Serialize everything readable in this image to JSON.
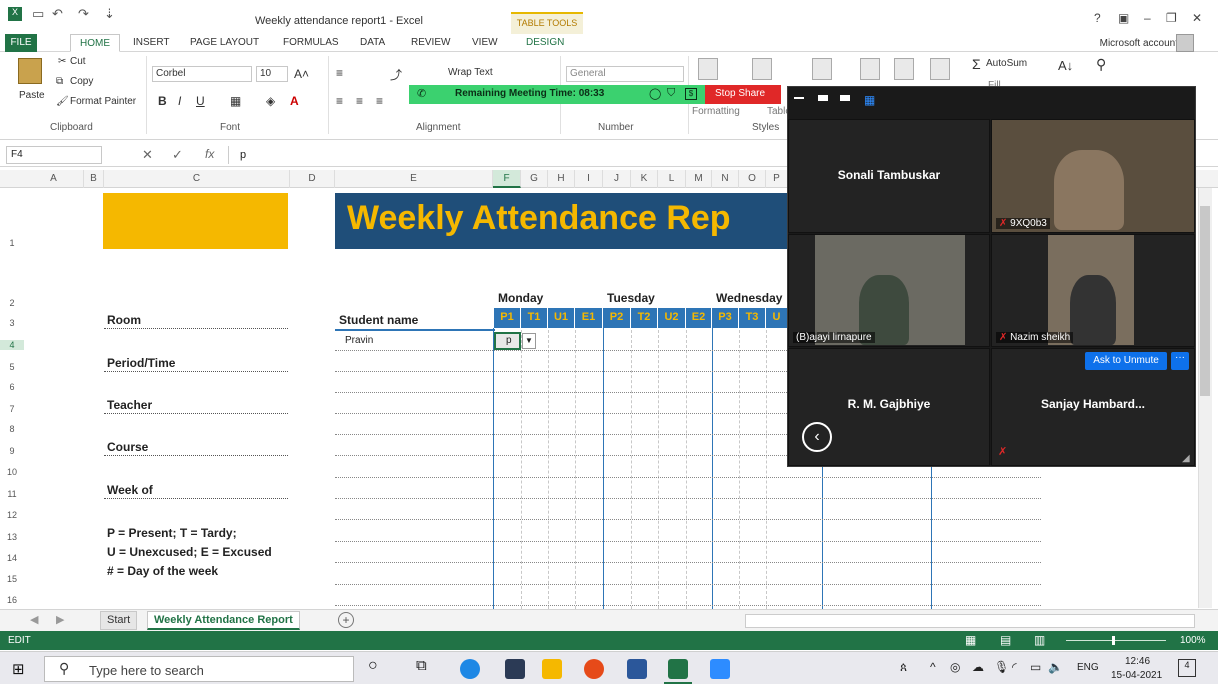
{
  "window": {
    "title": "Weekly attendance report1 - Excel",
    "table_tools": "TABLE TOOLS",
    "account": "Microsoft account",
    "controls": [
      "?",
      "▣",
      "–",
      "❐",
      "✕"
    ]
  },
  "ribbon_tabs": [
    "FILE",
    "HOME",
    "INSERT",
    "PAGE LAYOUT",
    "FORMULAS",
    "DATA",
    "REVIEW",
    "VIEW",
    "DESIGN"
  ],
  "ribbon": {
    "paste": "Paste",
    "cut": "Cut",
    "copy": "Copy",
    "format_painter": "Format Painter",
    "font_name": "Corbel",
    "font_size": "10",
    "wrap_text": "Wrap Text",
    "number_format": "General",
    "autosum": "AutoSum",
    "fill": "Fill",
    "formatting": "Formatting",
    "table": "Table",
    "groups": {
      "clipboard": "Clipboard",
      "font": "Font",
      "alignment": "Alignment",
      "number": "Number",
      "styles": "Styles"
    }
  },
  "formula_bar": {
    "name_box": "F4",
    "content": "p"
  },
  "columns": [
    "A",
    "B",
    "C",
    "D",
    "E",
    "F",
    "G",
    "H",
    "I",
    "J",
    "K",
    "L",
    "M",
    "N",
    "O",
    "P"
  ],
  "rows": [
    "1",
    "2",
    "3",
    "4",
    "5",
    "6",
    "7",
    "8",
    "9",
    "10",
    "11",
    "12",
    "13",
    "14",
    "15",
    "16"
  ],
  "sheet": {
    "banner": "Weekly Attendance Rep",
    "labels": {
      "room": "Room",
      "period": "Period/Time",
      "teacher": "Teacher",
      "course": "Course",
      "week_of": "Week of"
    },
    "student_name_header": "Student name",
    "first_student": "Pravin",
    "active_cell_value": "p",
    "days": [
      "Monday",
      "Tuesday",
      "Wednesday"
    ],
    "day_columns": [
      "P1",
      "T1",
      "U1",
      "E1",
      "P2",
      "T2",
      "U2",
      "E2",
      "P3",
      "T3",
      "U"
    ],
    "legend": [
      "P = Present; T = Tardy;",
      "U = Unexcused; E = Excused",
      "# = Day of the week"
    ]
  },
  "sheet_tabs": [
    "Start",
    "Weekly Attendance Report"
  ],
  "status": {
    "mode": "EDIT",
    "zoom": "100%"
  },
  "zoom_meeting": {
    "remaining_time": "Remaining Meeting Time: 08:33",
    "stop_share": "Stop Share",
    "participants": [
      {
        "name": "Sonali Tambuskar"
      },
      {
        "name": "9XQ0b3"
      },
      {
        "name": "(B)ajayi lirnapure"
      },
      {
        "name": "Nazim sheikh"
      },
      {
        "name": "R. M. Gajbhiye"
      },
      {
        "name": "Sanjay  Hambard..."
      }
    ],
    "ask_to_unmute": "Ask to Unmute",
    "more": "···"
  },
  "taskbar": {
    "search_placeholder": "Type here to search",
    "lang": "ENG",
    "time": "12:46",
    "date": "15-04-2021",
    "notif_count": "4"
  }
}
